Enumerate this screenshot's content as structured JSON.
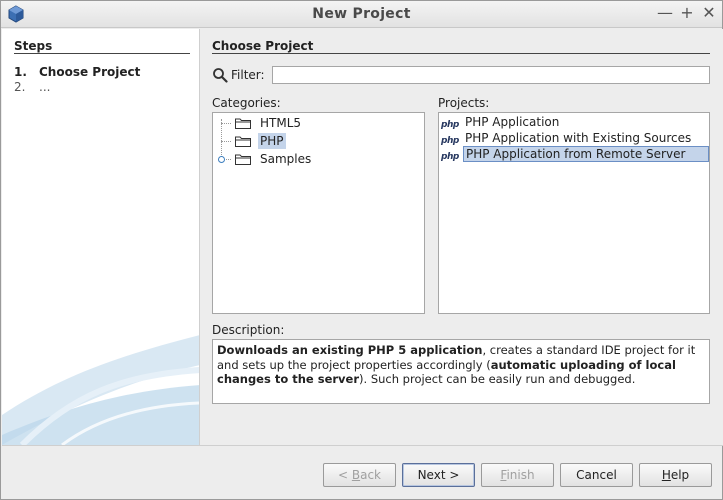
{
  "window": {
    "title": "New Project",
    "icon": "netbeans-cube-icon",
    "controls": {
      "minimize": "—",
      "maximize": "+",
      "close": "✕"
    }
  },
  "steps": {
    "title": "Steps",
    "items": [
      {
        "num": "1.",
        "label": "Choose Project"
      },
      {
        "num": "2.",
        "label": "..."
      }
    ]
  },
  "main": {
    "title": "Choose Project",
    "filter": {
      "label": "Filter:",
      "value": "",
      "placeholder": ""
    },
    "categories": {
      "label": "Categories:",
      "items": [
        {
          "label": "HTML5",
          "selected": false
        },
        {
          "label": "PHP",
          "selected": true
        },
        {
          "label": "Samples",
          "selected": false,
          "expandable": true
        }
      ]
    },
    "projects": {
      "label": "Projects:",
      "icon_text": "php",
      "items": [
        {
          "label": "PHP Application",
          "selected": false
        },
        {
          "label": "PHP Application with Existing Sources",
          "selected": false
        },
        {
          "label": "PHP Application from Remote Server",
          "selected": true
        }
      ]
    },
    "description": {
      "label": "Description:",
      "part1_bold": "Downloads an existing PHP 5 application",
      "part2": ", creates a standard IDE project for it and sets up the project properties accordingly (",
      "part3_bold": "automatic uploading of local changes to the server",
      "part4": "). Such project can be easily run and debugged."
    }
  },
  "buttons": {
    "back": {
      "pre": "< ",
      "mnemonic": "B",
      "post": "ack",
      "enabled": false
    },
    "next": {
      "label": "Next >",
      "enabled": true
    },
    "finish": {
      "mnemonic": "F",
      "post": "inish",
      "enabled": false
    },
    "cancel": {
      "label": "Cancel",
      "enabled": true
    },
    "help": {
      "mnemonic": "H",
      "post": "elp",
      "enabled": true
    }
  },
  "colors": {
    "selection": "#c4d4ea",
    "selection_border": "#6b8fc5",
    "panel_bg": "#ededed"
  }
}
